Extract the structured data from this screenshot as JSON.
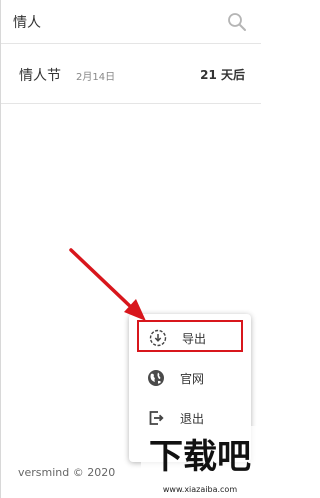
{
  "search": {
    "value": "情人",
    "icon": "search-icon"
  },
  "event": {
    "name": "情人节",
    "date": "2月14日",
    "countdown": "21 天后"
  },
  "footer": {
    "text": "versmind © 2020"
  },
  "menu": {
    "items": [
      {
        "label": "导出",
        "icon": "export-icon"
      },
      {
        "label": "官网",
        "icon": "globe-icon"
      },
      {
        "label": "退出",
        "icon": "logout-icon"
      }
    ]
  },
  "watermark": {
    "main": "下载吧",
    "url": "www.xiazaiba.com"
  },
  "colors": {
    "highlight": "#d8161c",
    "arrow": "#d8161c",
    "divider": "#e5e5e5"
  }
}
